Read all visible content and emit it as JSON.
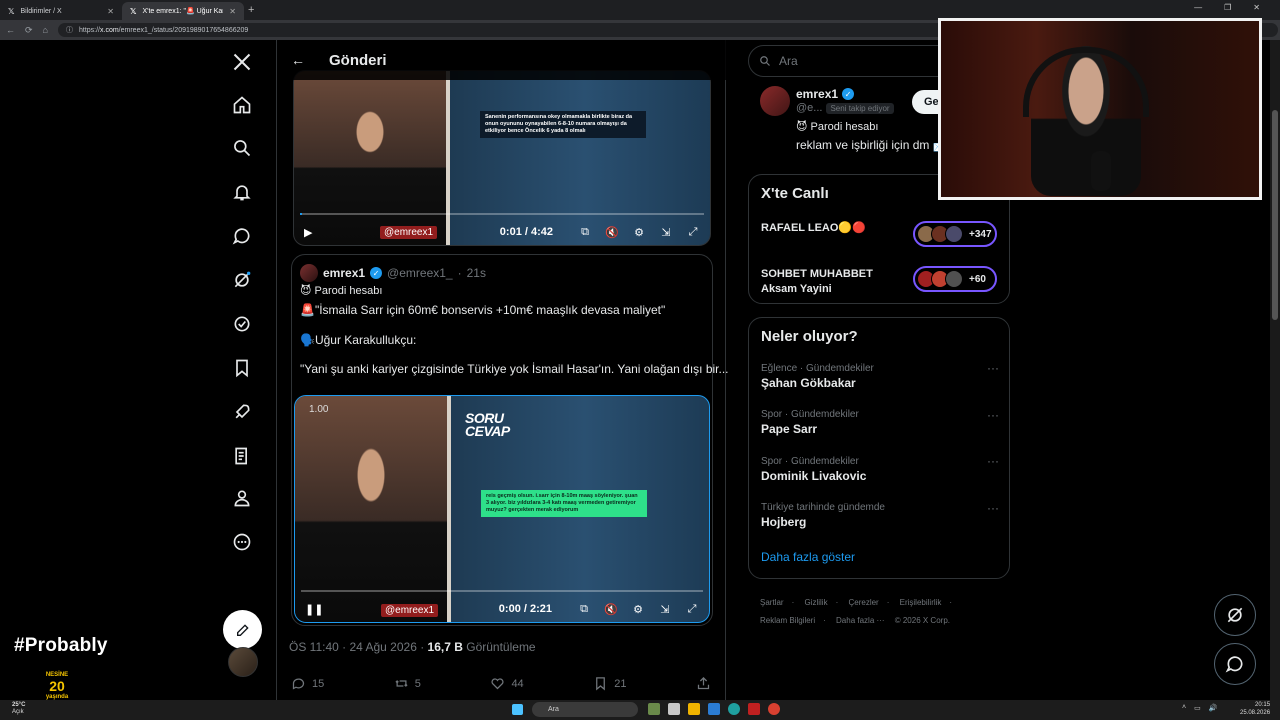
{
  "browser": {
    "tabs": [
      {
        "label": "Bildirimler / X",
        "active": false
      },
      {
        "label": "X'te emrex1: \"🚨 Uğur Karakullukçu",
        "active": true
      }
    ],
    "url_prefix": "https://",
    "url_host": "x.com",
    "url_path": "/emreex1_/status/2091989017654866209"
  },
  "header": {
    "title": "Gönderi"
  },
  "video1": {
    "time": "0:01 / 4:42",
    "progress": 0.004,
    "watermark": "@emreex1",
    "caption": "Sanenin performansına okey olmamakla birlikte biraz da onun oyununu oynayabilen 6-8-10 numara olmayışı da etkiliyor bence Öncelik 6 yada 8 olmalı"
  },
  "quoted": {
    "name": "emrex1",
    "handle": "@emreex1_",
    "age": "21s",
    "parody": "Parodi hesabı",
    "line1": "🚨\"İsmaila Sarr için 60m€ bonservis +10m€ maaşlık devasa maliyet\"",
    "line2": "🗣️Uğur Karakullukçu:",
    "line3": "\"Yani şu anki kariyer çizgisinde Türkiye yok İsmail Hasar'ın. Yani olağan dışı bir..."
  },
  "video2": {
    "time": "0:00 / 2:21",
    "progress": 0.0,
    "watermark": "@emreex1",
    "speed": "1.00",
    "soru": "SORU",
    "cevap": "CEVAP",
    "caption": "reis geçmiş olsun. i.sarr için 8-10m maaş söyleniyor. şuan 3 alıyor. biz yıldızlara 3-4 katı maaş vermeden getiremiyor muyuz? gerçekten merak ediyorum"
  },
  "tweet_meta": {
    "time": "ÖS 11:40 · 24 Ağu 2026 · ",
    "views_count": "16,7 B",
    "views_label": " Görüntüleme"
  },
  "actions": {
    "replies": "15",
    "reposts": "5",
    "likes": "44",
    "bookmarks": "21"
  },
  "search": {
    "placeholder": "Ara"
  },
  "profile": {
    "name": "emrex1",
    "handle": "@e...",
    "follows_you": "Seni takip ediyor",
    "follow_label": "Ge",
    "bio1": "Parodi hesabı",
    "bio2": "reklam ve işbirliği için dm 📩"
  },
  "live": {
    "title": "X'te Canlı",
    "items": [
      {
        "title": "RAFAEL LEAO🟡🔴",
        "count": "+347"
      },
      {
        "title": "SOHBET MUHABBET",
        "subtitle": "Aksam Yayini",
        "count": "+60"
      }
    ]
  },
  "trends": {
    "title": "Neler oluyor?",
    "items": [
      {
        "category": "Eğlence · Gündemdekiler",
        "name": "Şahan Gökbakar"
      },
      {
        "category": "Spor · Gündemdekiler",
        "name": "Pape Sarr"
      },
      {
        "category": "Spor · Gündemdekiler",
        "name": "Dominik Livakovic"
      },
      {
        "category": "Türkiye tarihinde gündemde",
        "name": "Hojberg"
      }
    ],
    "more": "Daha fazla göster",
    "more_dots": "···"
  },
  "footer": {
    "links": [
      "Şartlar",
      "Gizlilik",
      "Çerezler",
      "Erişilebilirlik",
      "Reklam Bilgileri",
      "Daha fazla ···",
      "© 2026 X Corp."
    ]
  },
  "overlay": {
    "brand": "#Probably",
    "nesine_top": "NESİNE",
    "nesine_num": "20",
    "nesine_bottom": "yaşında"
  },
  "taskbar": {
    "temp": "25°C",
    "weather": "Açık",
    "search": "Ara",
    "time": "20:15",
    "date": "25.08.2026"
  },
  "colors": {
    "accent": "#1d9bf0",
    "live_ring": "#7856ff",
    "background": "#000000"
  }
}
